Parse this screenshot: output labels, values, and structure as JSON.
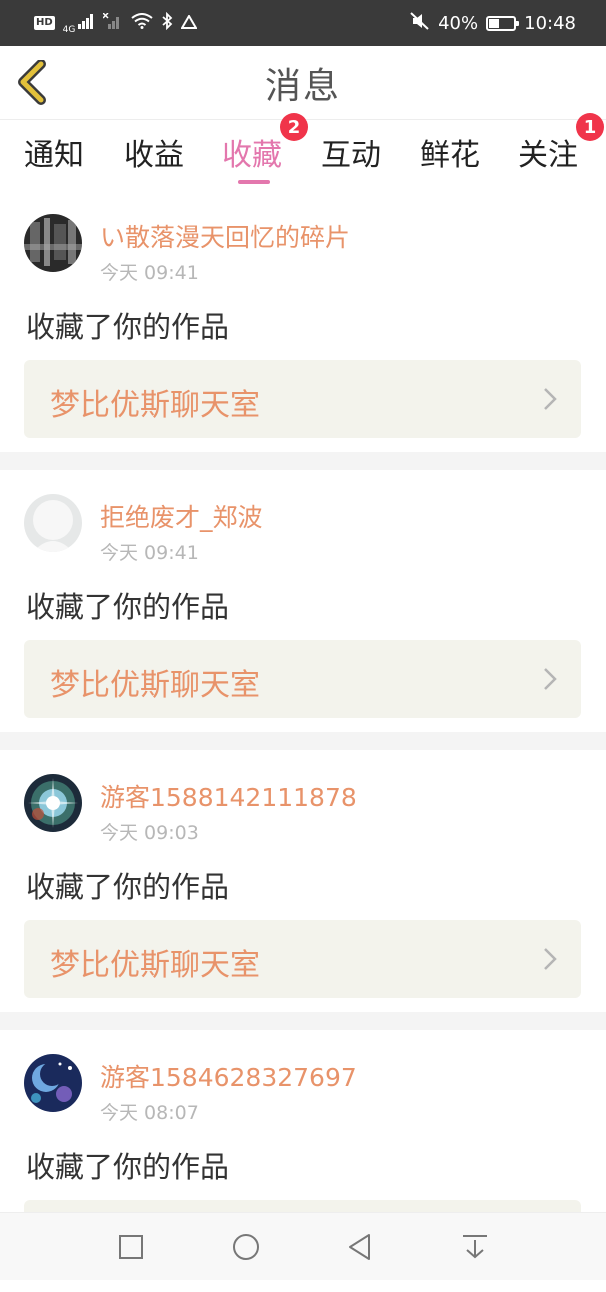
{
  "status_bar": {
    "hd": "HD",
    "network": "4G",
    "battery_text": "40%",
    "battery_level": 0.4,
    "time": "10:48"
  },
  "header": {
    "title": "消息"
  },
  "tabs": [
    {
      "label": "通知"
    },
    {
      "label": "收益"
    },
    {
      "label": "收藏",
      "badge": "2",
      "active": true
    },
    {
      "label": "互动"
    },
    {
      "label": "鲜花"
    },
    {
      "label": "关注",
      "badge": "1"
    }
  ],
  "items": [
    {
      "username": "い散落漫天回忆的碎片",
      "time": "今天 09:41",
      "action": "收藏了你的作品",
      "work": "梦比优斯聊天室"
    },
    {
      "username": "拒绝废才_郑波",
      "time": "今天 09:41",
      "action": "收藏了你的作品",
      "work": "梦比优斯聊天室"
    },
    {
      "username": "游客1588142111878",
      "time": "今天 09:03",
      "action": "收藏了你的作品",
      "work": "梦比优斯聊天室"
    },
    {
      "username": "游客1584628327697",
      "time": "今天 08:07",
      "action": "收藏了你的作品",
      "work": ""
    }
  ],
  "colors": {
    "accent_pink": "#e377ad",
    "name_orange": "#e8936a",
    "badge_red": "#f0344a",
    "back_arrow": "#e3c13b"
  }
}
